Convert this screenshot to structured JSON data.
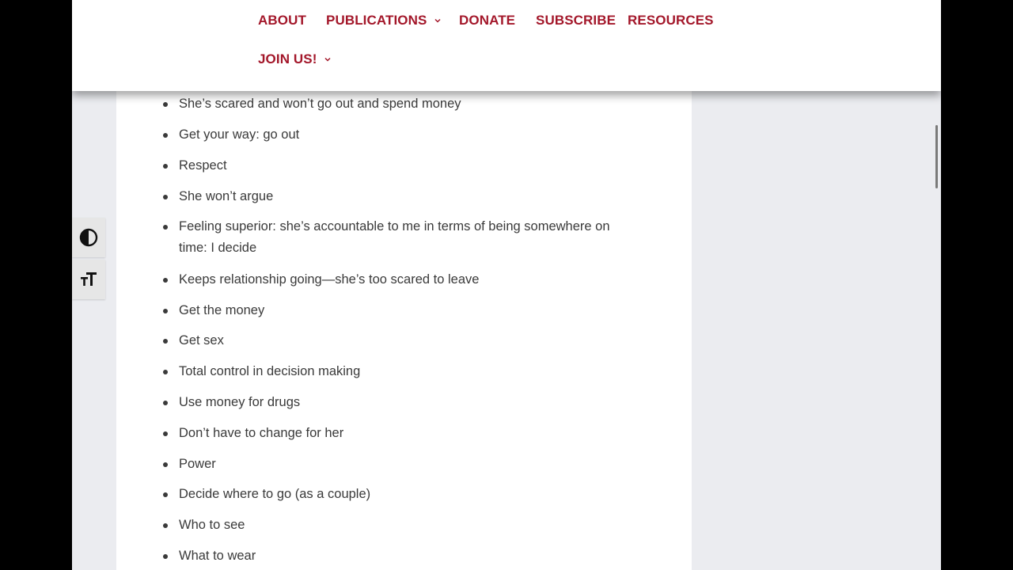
{
  "nav": {
    "items": [
      {
        "label": "ABOUT",
        "has_dropdown": false
      },
      {
        "label": "PUBLICATIONS",
        "has_dropdown": true
      },
      {
        "label": "DONATE",
        "has_dropdown": false
      },
      {
        "label": "SUBSCRIBE",
        "has_dropdown": false
      },
      {
        "label": "RESOURCES",
        "has_dropdown": false
      },
      {
        "label": "JOIN US!",
        "has_dropdown": true
      }
    ],
    "color": "#a3172a"
  },
  "content": {
    "list_items": [
      "She’s scared and won’t go out and spend money",
      "Get your way: go out",
      "Respect",
      "She won’t argue",
      "Feeling superior: she’s accountable to me in terms of being somewhere on time: I decide",
      "Keeps relationship going—she’s too scared to leave",
      "Get the money",
      "Get sex",
      "Total control in decision making",
      "Use money for drugs",
      "Don’t have to change for her",
      "Power",
      "Decide where to go (as a couple)",
      "Who to see",
      "What to wear"
    ]
  },
  "accessibility_toolbar": {
    "buttons": [
      {
        "icon": "contrast-icon",
        "glyph": "◐"
      },
      {
        "icon": "text-size-icon",
        "glyph": "ₜT"
      }
    ]
  }
}
